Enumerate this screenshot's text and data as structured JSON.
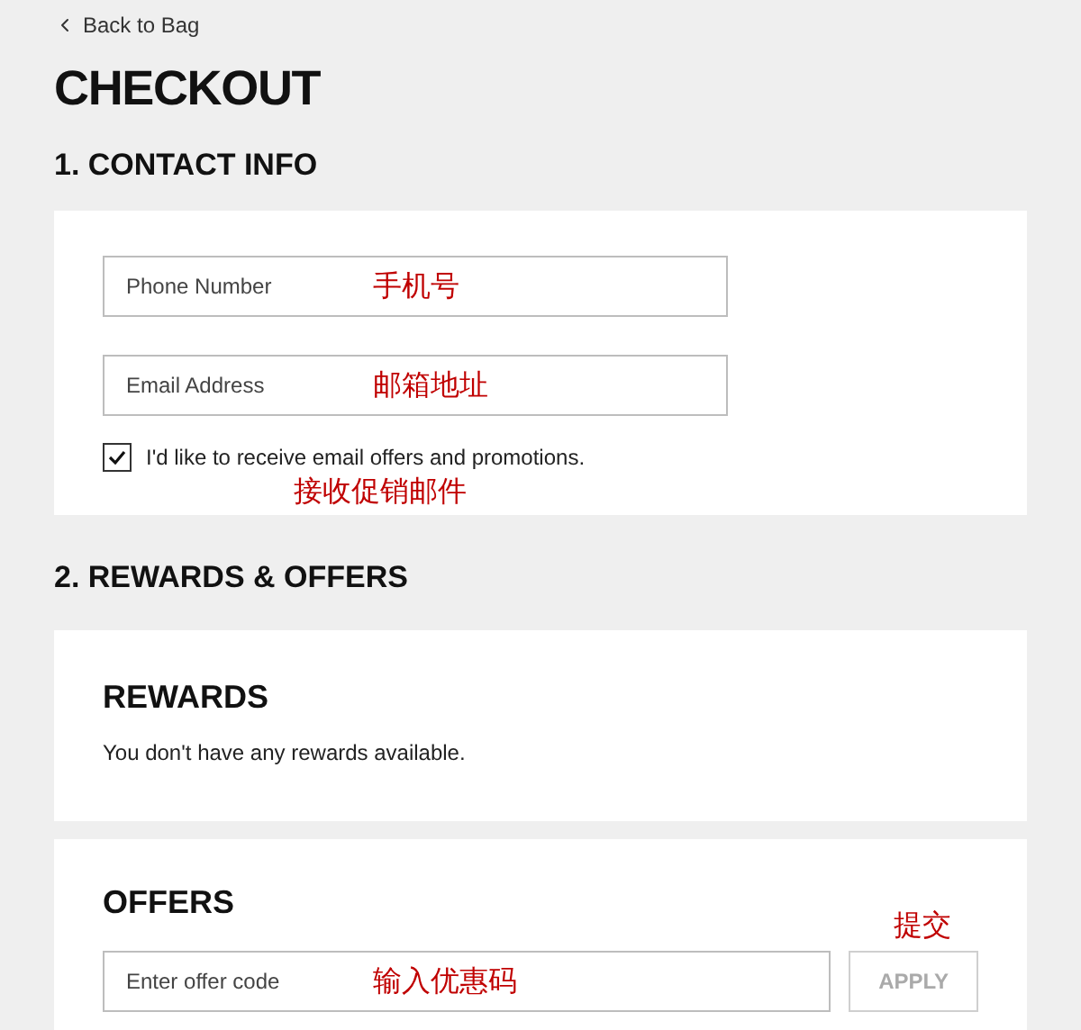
{
  "back_link": {
    "label": "Back to Bag"
  },
  "title": "CHECKOUT",
  "contact": {
    "heading": "1. CONTACT INFO",
    "fields": [
      {
        "placeholder": "Phone Number",
        "note": "手机号"
      },
      {
        "placeholder": "Email Address",
        "note": "邮箱地址"
      }
    ],
    "opt_in": {
      "label": "I'd like to receive email offers and promotions.",
      "checked": true,
      "note": "接收促销邮件"
    }
  },
  "rewards_offers": {
    "heading": "2. REWARDS & OFFERS",
    "rewards": {
      "title": "REWARDS",
      "message": "You don't have any rewards available."
    },
    "offers": {
      "title": "OFFERS",
      "field": {
        "placeholder": "Enter offer code",
        "note": "输入优惠码"
      },
      "apply": {
        "label": "APPLY",
        "disabled": true,
        "note": "提交"
      }
    }
  }
}
